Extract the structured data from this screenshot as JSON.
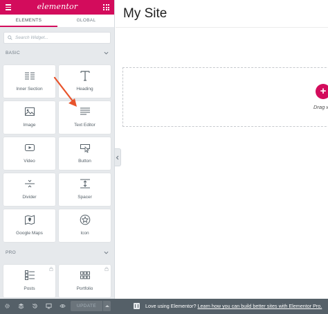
{
  "panel": {
    "logo_text": "elementor",
    "tabs": [
      {
        "label": "ELEMENTS",
        "active": true
      },
      {
        "label": "GLOBAL",
        "active": false
      }
    ],
    "search": {
      "placeholder": "Search Widget..."
    },
    "sections": [
      {
        "label": "BASIC"
      },
      {
        "label": "PRO"
      }
    ],
    "basic_widgets": [
      {
        "label": "Inner Section",
        "icon": "inner-section-icon"
      },
      {
        "label": "Heading",
        "icon": "heading-icon"
      },
      {
        "label": "Image",
        "icon": "image-icon"
      },
      {
        "label": "Text Editor",
        "icon": "text-editor-icon"
      },
      {
        "label": "Video",
        "icon": "video-icon"
      },
      {
        "label": "Button",
        "icon": "button-icon"
      },
      {
        "label": "Divider",
        "icon": "divider-icon"
      },
      {
        "label": "Spacer",
        "icon": "spacer-icon"
      },
      {
        "label": "Google Maps",
        "icon": "google-maps-icon"
      },
      {
        "label": "Icon",
        "icon": "star-icon"
      }
    ],
    "pro_widgets": [
      {
        "label": "Posts",
        "icon": "posts-icon",
        "locked": true
      },
      {
        "label": "Portfolio",
        "icon": "portfolio-icon",
        "locked": true
      }
    ]
  },
  "footer": {
    "icons": [
      "settings-icon",
      "navigator-icon",
      "history-icon",
      "responsive-icon",
      "preview-icon"
    ],
    "update_label": "UPDATE"
  },
  "preview": {
    "site_title": "My Site",
    "drag_text": "Drag w"
  },
  "notice": {
    "text": "Love using Elementor? ",
    "link_text": "Learn how you can build better sites with Elementor Pro."
  },
  "colors": {
    "brand": "#d30c5c",
    "panel_bg": "#e6e9ec",
    "footer_bg": "#556068",
    "annotation": "#e8542c"
  }
}
